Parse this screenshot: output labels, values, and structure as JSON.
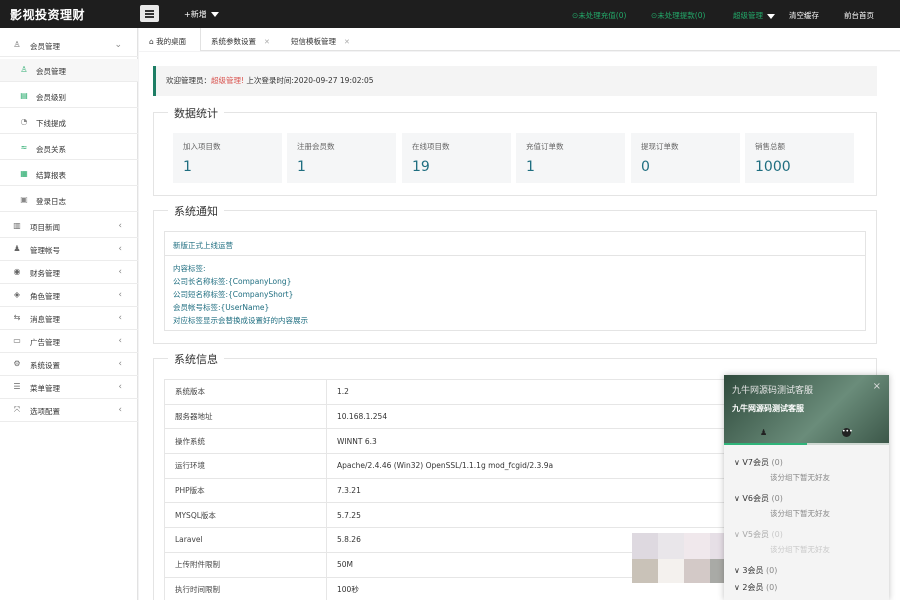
{
  "header": {
    "brand": "影视投资理财",
    "add_new": "+新增",
    "pending_recharge": "未处理充值(0)",
    "pending_withdraw": "未处理提款(0)",
    "admin_menu": "超级管理",
    "clear_cache": "清空缓存",
    "frontend_home": "前台首页"
  },
  "sidebar": {
    "items": [
      {
        "label": "会员管理",
        "icon": "user-icon",
        "type": "group",
        "expanded": true
      },
      {
        "label": "会员管理",
        "icon": "user-icon",
        "type": "sub"
      },
      {
        "label": "会员级别",
        "icon": "level-icon",
        "type": "sub"
      },
      {
        "label": "下线提成",
        "icon": "commission-icon",
        "type": "sub"
      },
      {
        "label": "会员关系",
        "icon": "relation-icon",
        "type": "sub"
      },
      {
        "label": "结算报表",
        "icon": "report-icon",
        "type": "sub"
      },
      {
        "label": "登录日志",
        "icon": "log-icon",
        "type": "sub"
      },
      {
        "label": "项目新闻",
        "icon": "news-icon",
        "type": "group"
      },
      {
        "label": "管理帐号",
        "icon": "account-icon",
        "type": "group"
      },
      {
        "label": "财务管理",
        "icon": "finance-icon",
        "type": "group"
      },
      {
        "label": "角色管理",
        "icon": "role-icon",
        "type": "group"
      },
      {
        "label": "消息管理",
        "icon": "message-icon",
        "type": "group"
      },
      {
        "label": "广告管理",
        "icon": "ad-icon",
        "type": "group"
      },
      {
        "label": "系统设置",
        "icon": "settings-icon",
        "type": "group"
      },
      {
        "label": "菜单管理",
        "icon": "menu-icon",
        "type": "group"
      },
      {
        "label": "选项配置",
        "icon": "options-icon",
        "type": "group"
      }
    ]
  },
  "tabs": [
    {
      "label": "我的桌面",
      "active": true,
      "icon": "home-icon"
    },
    {
      "label": "系统参数设置",
      "active": false
    },
    {
      "label": "短信模板管理",
      "active": false
    }
  ],
  "welcome": {
    "prefix": "欢迎管理员：",
    "admin": "超级管理!",
    "suffix": " 上次登录时间:2020-09-27 19:02:05"
  },
  "stats": {
    "title": "数据统计",
    "items": [
      {
        "label": "加入项目数",
        "value": "1"
      },
      {
        "label": "注册会员数",
        "value": "1"
      },
      {
        "label": "在线项目数",
        "value": "19"
      },
      {
        "label": "充值订单数",
        "value": "1"
      },
      {
        "label": "提现订单数",
        "value": "0"
      },
      {
        "label": "销售总额",
        "value": "1000"
      }
    ]
  },
  "notice": {
    "title": "系统通知",
    "headline": "新版正式上线运营",
    "lines": [
      "内容标签:",
      "公司长名称标签:{CompanyLong}",
      "公司短名称标签:{CompanyShort}",
      "会员帐号标签:{UserName}",
      "对应标签显示会替换成设置好的内容展示"
    ]
  },
  "sysinfo": {
    "title": "系统信息",
    "rows": [
      {
        "key": "系统版本",
        "value": "1.2"
      },
      {
        "key": "服务器地址",
        "value": "10.168.1.254"
      },
      {
        "key": "操作系统",
        "value": "WINNT 6.3"
      },
      {
        "key": "运行环境",
        "value": "Apache/2.4.46 (Win32) OpenSSL/1.1.1g mod_fcgid/2.3.9a"
      },
      {
        "key": "PHP版本",
        "value": "7.3.21"
      },
      {
        "key": "MYSQL版本",
        "value": "5.7.25"
      },
      {
        "key": "Laravel",
        "value": "5.8.26"
      },
      {
        "key": "上传附件限制",
        "value": "50M"
      },
      {
        "key": "执行时间限制",
        "value": "100秒"
      }
    ]
  },
  "chat": {
    "title": "九牛网源码测试客服",
    "name": "九牛网源码测试客服",
    "close": "×",
    "groups": [
      {
        "label": "V7会员",
        "count": "(0)",
        "empty": "该分组下暂无好友"
      },
      {
        "label": "V6会员",
        "count": "(0)",
        "empty": "该分组下暂无好友"
      },
      {
        "label": "V5会员",
        "count": "(0)",
        "empty": "该分组下暂无好友"
      },
      {
        "label": "3会员",
        "count": "(0)",
        "empty": ""
      },
      {
        "label": "2会员",
        "count": "(0)",
        "empty": ""
      }
    ]
  }
}
